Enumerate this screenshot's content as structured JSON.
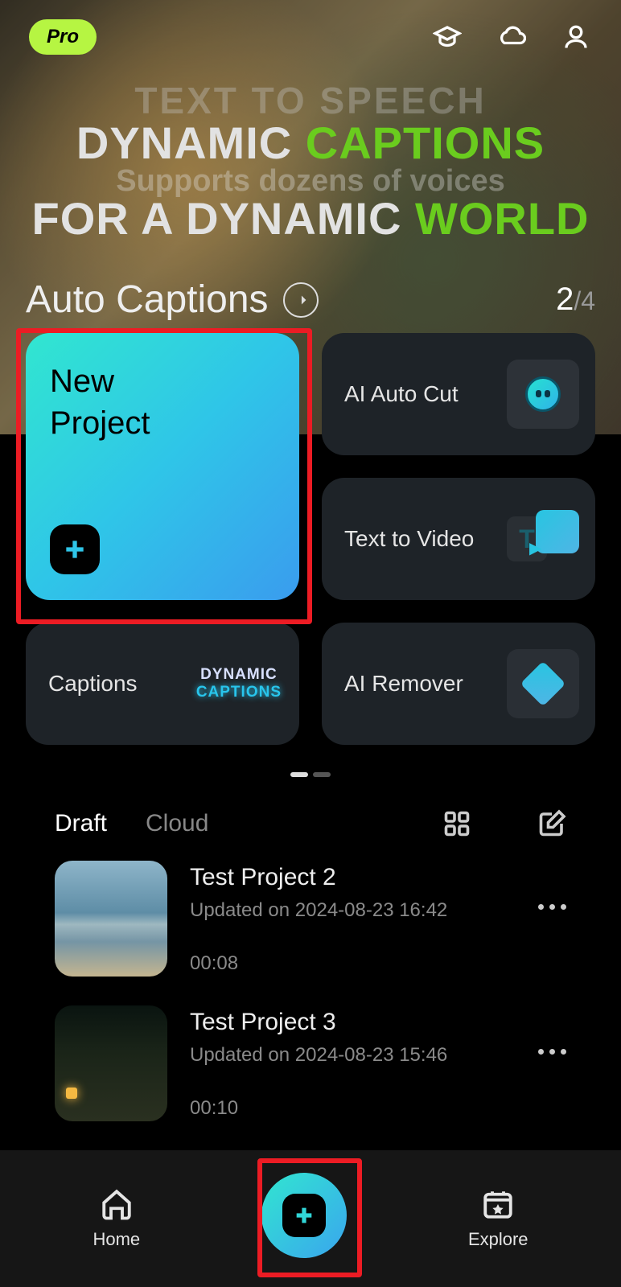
{
  "topbar": {
    "pro_label": "Pro"
  },
  "hero": {
    "faded_top": "TEXT TO SPEECH",
    "line1_a": "DYNAMIC ",
    "line1_b": "CAPTIONS",
    "subtitle": "Supports dozens of voices",
    "line2_a": "FOR A DYNAMIC ",
    "line2_b": "WORLD",
    "title": "Auto Captions",
    "pager_current": "2",
    "pager_sep": "/",
    "pager_total": "4"
  },
  "cards": {
    "new_project": "New\nProject",
    "ai_auto_cut": "AI Auto Cut",
    "text_to_video": "Text to Video",
    "captions": "Captions",
    "captions_thumb_l1": "DYNAMIC",
    "captions_thumb_l2": "CAPTIONS",
    "ai_remover": "AI Remover"
  },
  "tabs": {
    "draft": "Draft",
    "cloud": "Cloud"
  },
  "projects": [
    {
      "title": "Test Project 2",
      "subtitle": "Updated on 2024-08-23 16:42",
      "duration": "00:08"
    },
    {
      "title": "Test Project 3",
      "subtitle": "Updated on 2024-08-23 15:46",
      "duration": "00:10"
    }
  ],
  "nav": {
    "home": "Home",
    "explore": "Explore"
  }
}
